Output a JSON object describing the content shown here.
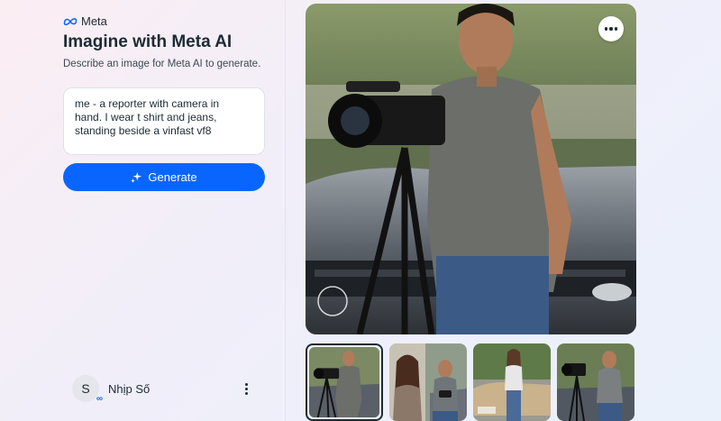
{
  "brand": {
    "name": "Meta",
    "logo_icon": "meta-infinity-icon",
    "logo_color": "#0866ff"
  },
  "header": {
    "title": "Imagine with Meta AI",
    "subtitle": "Describe an image for Meta AI to generate."
  },
  "prompt": {
    "value": "me - a reporter with camera in\nhand. I wear t shirt and jeans,\nstanding beside a vinfast vf8"
  },
  "generate_button": {
    "label": "Generate",
    "icon": "sparkle-icon",
    "color": "#0866ff"
  },
  "user": {
    "initial": "S",
    "name": "Nhịp Số",
    "badge_icon": "meta-infinity-icon"
  },
  "main_image": {
    "alt": "man with camera on tripod beside a car",
    "menu_icon": "more-horizontal-icon"
  },
  "thumbnails": [
    {
      "alt": "man with camera on tripod beside a car",
      "selected": true
    },
    {
      "alt": "woman and man with camera",
      "selected": false
    },
    {
      "alt": "woman standing beside a car",
      "selected": false
    },
    {
      "alt": "man with camera on tripod",
      "selected": false
    }
  ]
}
